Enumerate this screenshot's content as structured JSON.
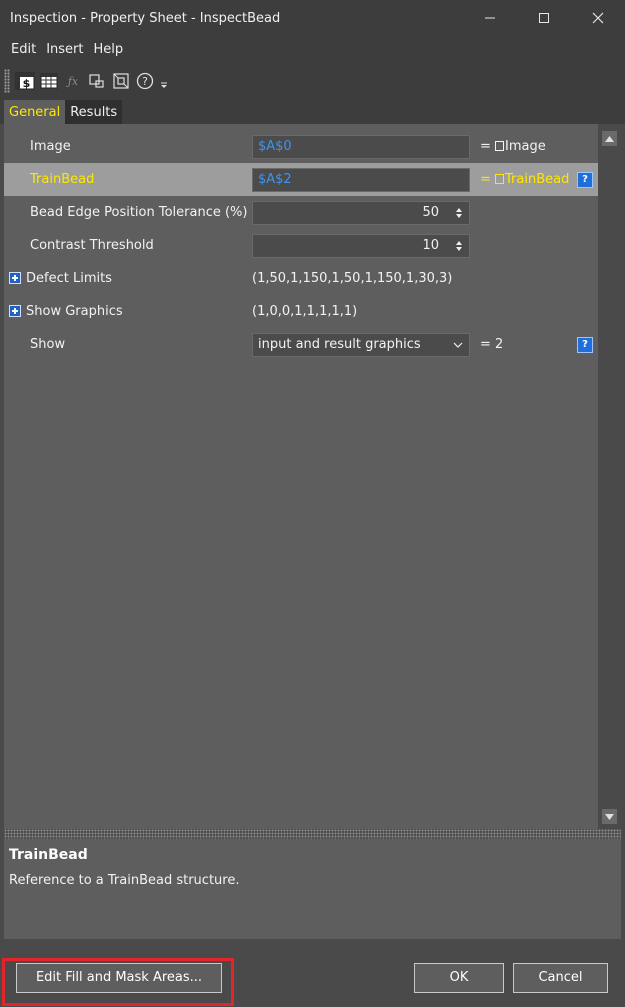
{
  "window": {
    "title": "Inspection - Property Sheet - InspectBead",
    "minimize_glyph": "—",
    "maximize_glyph": "☐",
    "close_glyph": "✕"
  },
  "menu": {
    "items": [
      "Edit",
      "Insert",
      "Help"
    ]
  },
  "toolbar": {
    "icons": [
      "spreadsheet-dollar-icon",
      "grid-icon",
      "function-icon",
      "zoom-region-icon",
      "fit-region-icon",
      "help-circle-icon",
      "overflow-arrow-icon"
    ]
  },
  "tabs": [
    {
      "label": "General",
      "active": true
    },
    {
      "label": "Results",
      "active": false
    }
  ],
  "properties": [
    {
      "label": "Image",
      "value": "$A$0",
      "kind": "ref",
      "result": "Image",
      "has_help": false,
      "selected": false
    },
    {
      "label": "TrainBead",
      "value": "$A$2",
      "kind": "ref",
      "result": "TrainBead",
      "has_help": true,
      "selected": true
    },
    {
      "label": "Bead Edge Position Tolerance (%)",
      "value": "50",
      "kind": "spin"
    },
    {
      "label": "Contrast Threshold",
      "value": "10",
      "kind": "spin"
    },
    {
      "label": "Defect Limits",
      "value": "(1,50,1,150,1,50,1,150,1,30,3)",
      "kind": "group"
    },
    {
      "label": "Show Graphics",
      "value": "(1,0,0,1,1,1,1,1)",
      "kind": "group"
    },
    {
      "label": "Show",
      "value": "input and result graphics",
      "kind": "select",
      "result": "= 2",
      "has_help": true
    }
  ],
  "eq_prefix": "= ",
  "help_glyph": "?",
  "description": {
    "title": "TrainBead",
    "text": "Reference to a TrainBead structure."
  },
  "buttons": {
    "edit_fill_mask": "Edit Fill and Mask Areas...",
    "ok": "OK",
    "cancel": "Cancel"
  },
  "colors": {
    "accent_yellow": "#ffe800",
    "reference_blue": "#3f93ef",
    "highlight_red": "#e3242b"
  }
}
